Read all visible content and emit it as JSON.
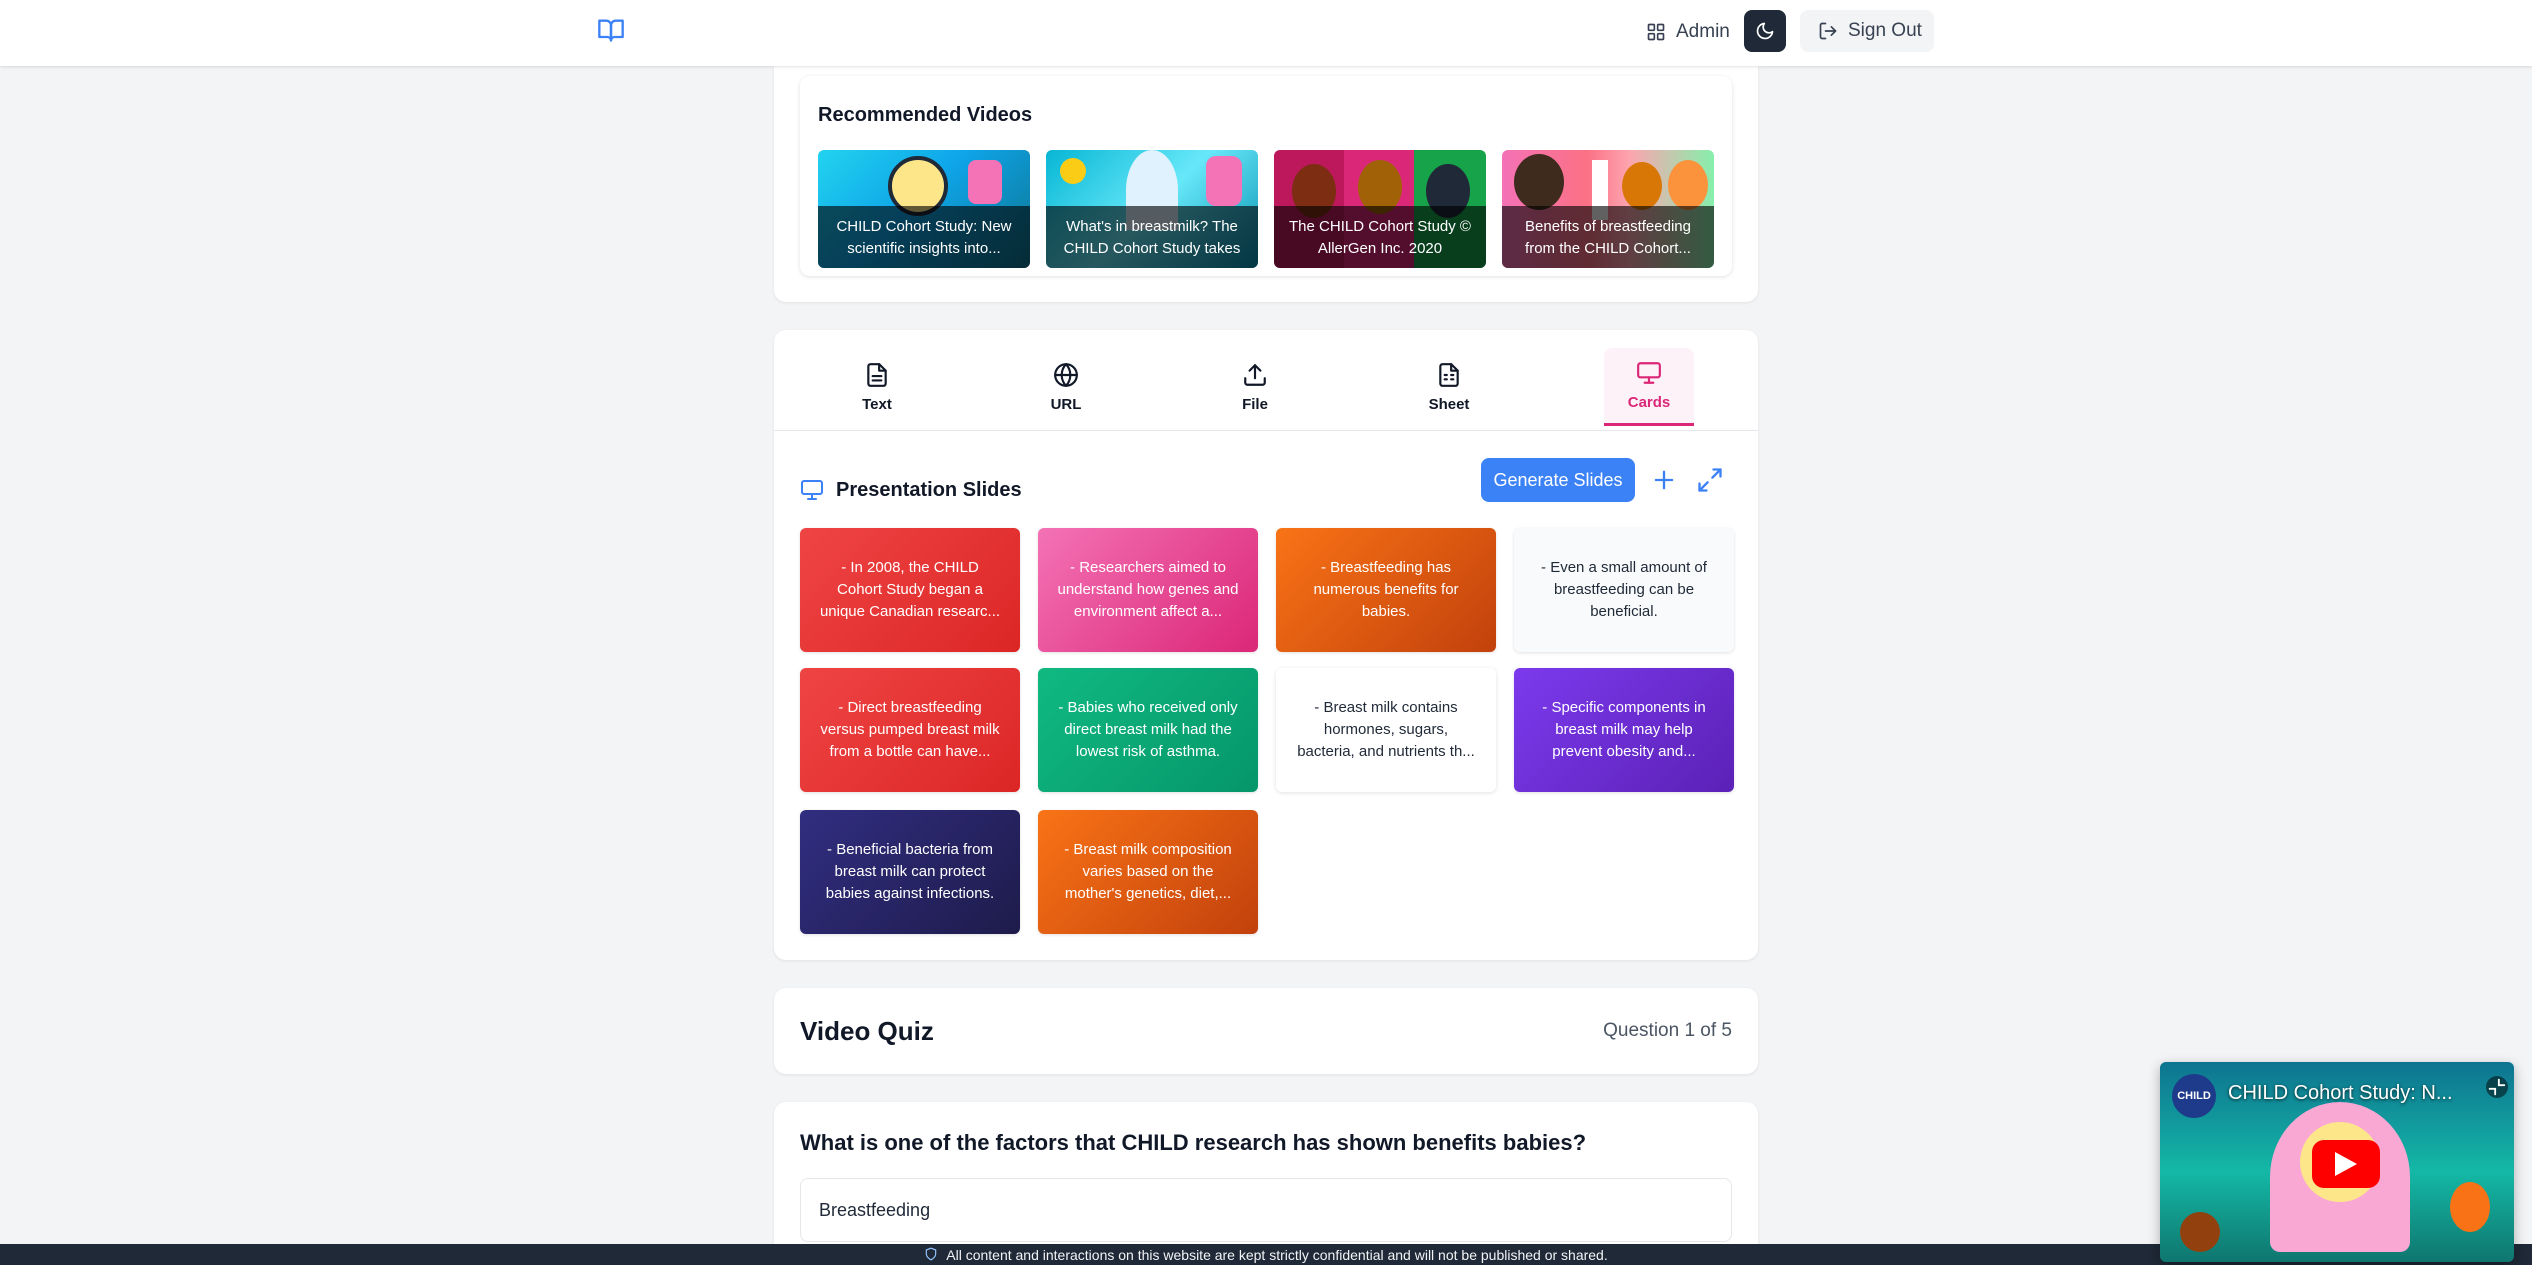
{
  "header": {
    "admin_label": "Admin",
    "signout_label": "Sign Out",
    "logo_icon": "book-open-icon",
    "theme_icon": "moon-icon"
  },
  "recommended": {
    "title": "Recommended Videos",
    "videos": [
      {
        "caption": "CHILD Cohort Study: New scientific insights into..."
      },
      {
        "caption": "What's in breastmilk? The CHILD Cohort Study takes ..."
      },
      {
        "caption": "The CHILD Cohort Study © AllerGen Inc. 2020"
      },
      {
        "caption": "Benefits of breastfeeding from the CHILD Cohort..."
      }
    ]
  },
  "tabs": [
    {
      "label": "Text",
      "icon": "file-text-icon"
    },
    {
      "label": "URL",
      "icon": "globe-icon"
    },
    {
      "label": "File",
      "icon": "upload-icon"
    },
    {
      "label": "Sheet",
      "icon": "sheet-icon"
    },
    {
      "label": "Cards",
      "icon": "presentation-icon",
      "active": true
    }
  ],
  "slides_section": {
    "title": "Presentation Slides",
    "generate_label": "Generate Slides",
    "slides": [
      {
        "text": "- In 2008, the CHILD Cohort Study began a unique Canadian researc...",
        "color": "#dc2626"
      },
      {
        "text": "- Researchers aimed to understand how genes and environment affect a...",
        "color": "#ec4899"
      },
      {
        "text": "- Breastfeeding has numerous benefits for babies.",
        "color": "#ea580c"
      },
      {
        "text": "- Even a small amount of breastfeeding can be beneficial.",
        "color": "#f9fafb"
      },
      {
        "text": "- Direct breastfeeding versus pumped breast milk from a bottle can have...",
        "color": "#dc2626"
      },
      {
        "text": "- Babies who received only direct breast milk had the lowest risk of asthma.",
        "color": "#059669"
      },
      {
        "text": "- Breast milk contains hormones, sugars, bacteria, and nutrients th...",
        "color": "#ffffff"
      },
      {
        "text": "- Specific components in breast milk may help prevent obesity and...",
        "color": "#7c3aed"
      },
      {
        "text": "- Beneficial bacteria from breast milk can protect babies against infections.",
        "color": "#312e81"
      },
      {
        "text": "- Breast milk composition varies based on the mother's genetics, diet,...",
        "color": "#ea580c"
      }
    ]
  },
  "quiz": {
    "title": "Video Quiz",
    "progress": "Question 1 of 5",
    "question": "What is one of the factors that CHILD research has shown benefits babies?",
    "options": [
      "Breastfeeding"
    ]
  },
  "footer": {
    "text": "All content and interactions on this website are kept strictly confidential and will not be published or shared."
  },
  "mini_player": {
    "title": "CHILD Cohort Study: N...",
    "channel_badge": "CHILD"
  },
  "colors": {
    "accent_blue": "#3b82f6",
    "accent_pink": "#db2777"
  }
}
